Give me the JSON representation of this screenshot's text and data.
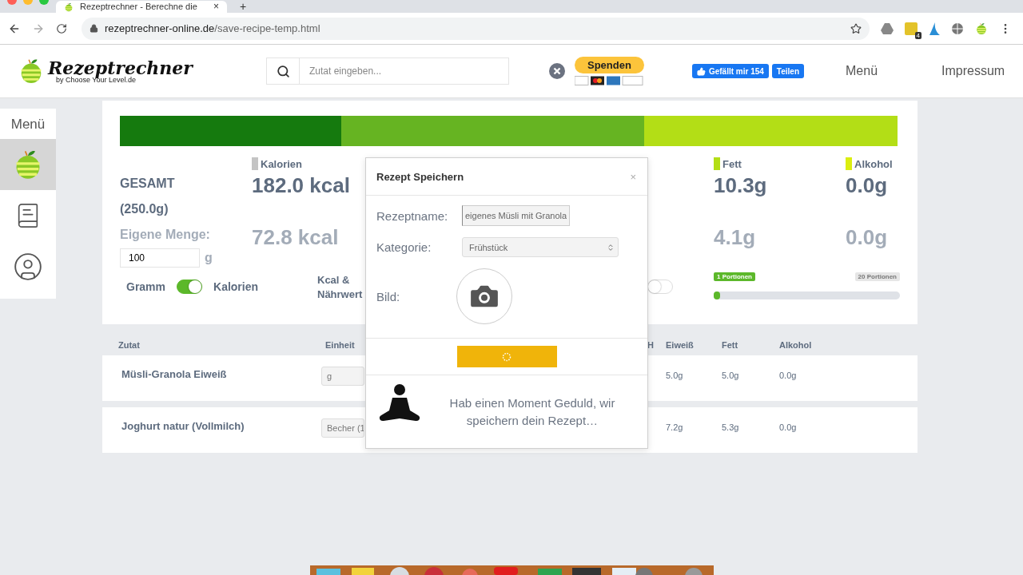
{
  "browser": {
    "tab_title": "Rezeptrechner - Berechne die",
    "tab_close": "×",
    "new_tab": "+",
    "url_host": "rezeptrechner-online.de",
    "url_path": "/save-recipe-temp.html",
    "extension_badge": "4"
  },
  "header": {
    "logo_title": "Rezeptrechner",
    "logo_subtitle": "by Choose Your Level.de",
    "search": {
      "placeholder": "Zutat eingeben..."
    },
    "donate": "Spenden",
    "like_label": "Gefällt mir",
    "like_count": "154",
    "share": "Teilen",
    "nav": [
      "Menü",
      "Impressum"
    ]
  },
  "sidebar": {
    "title": "Menü",
    "items": [
      {
        "kind": "apple",
        "selected": true
      },
      {
        "kind": "book",
        "selected": false
      },
      {
        "kind": "user",
        "selected": false
      }
    ]
  },
  "macro_bar": [
    {
      "color": "#157a0e"
    },
    {
      "color": "#66b422"
    },
    {
      "color": "#b3de16"
    }
  ],
  "summary": {
    "title": "GESAMT",
    "weight": "(250.0g)",
    "own_amount_label": "Eigene Menge:",
    "own_amount": "100",
    "unit": "g"
  },
  "stats": [
    {
      "label": "Kalorien",
      "color": "#c4c4c4",
      "total": "182.0 kcal",
      "own": "72.8 kcal"
    },
    {
      "label": "Fett",
      "color": "#b3de16",
      "total": "10.3g",
      "own": "4.1g"
    },
    {
      "label": "Alkohol",
      "color": "#dbee10",
      "total": "0.0g",
      "own": "0.0g"
    }
  ],
  "mode_toggle": {
    "left": "Gramm",
    "right": "Kalorien",
    "on": true
  },
  "kcal_toggle": {
    "label": "Kcal & Nährwert",
    "on": false
  },
  "portions": {
    "min_label": "1 Portionen",
    "max_label": "20 Portionen",
    "level": 0.0
  },
  "table": {
    "columns": [
      "Zutat",
      "Einheit",
      "H",
      "Eiweiß",
      "Fett",
      "Alkohol"
    ],
    "rows": [
      {
        "name": "Müsli-Granola Eiweiß",
        "unit": "g",
        "cells": [
          "5.0g",
          "5.0g",
          "0.0g"
        ]
      },
      {
        "name": "Joghurt natur (Vollmilch)",
        "unit": "Becher (1",
        "cells": [
          "7.2g",
          "5.3g",
          "0.0g"
        ]
      }
    ]
  },
  "modal": {
    "title": "Rezept Speichern",
    "close": "×",
    "fields": [
      {
        "kind": "text",
        "label": "Rezeptname:",
        "value": "eigenes Müsli mit Granola"
      },
      {
        "kind": "select",
        "label": "Kategorie:",
        "value": "Frühstück"
      },
      {
        "kind": "image",
        "label": "Bild:"
      }
    ],
    "saving": true,
    "message": "Hab einen Moment Geduld, wir speichern dein Rezept…"
  }
}
